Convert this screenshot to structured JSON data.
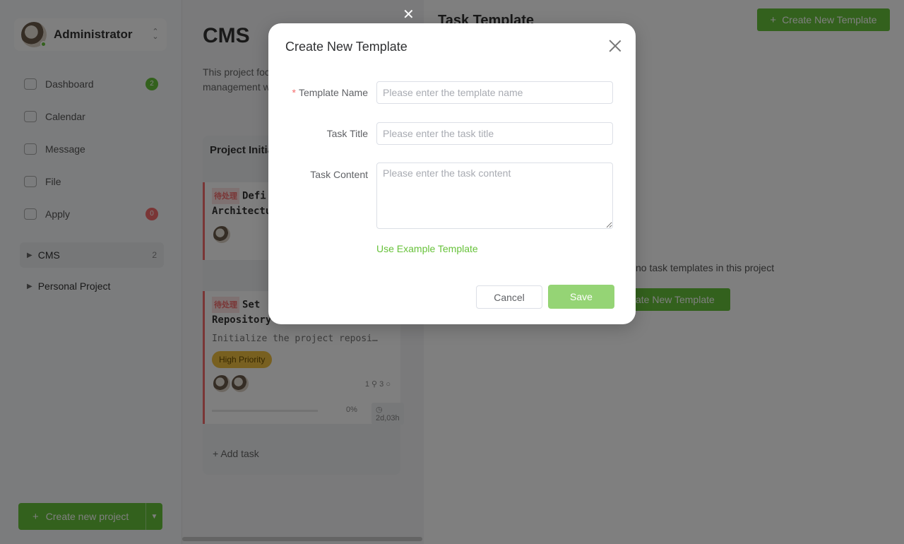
{
  "sidebar": {
    "user_name": "Administrator",
    "nav": [
      {
        "label": "Dashboard",
        "badge": "2",
        "badge_color": "#67c23a"
      },
      {
        "label": "Calendar"
      },
      {
        "label": "Message"
      },
      {
        "label": "File"
      },
      {
        "label": "Apply",
        "badge": "0",
        "badge_color": "#f56c6c"
      }
    ],
    "projects": [
      {
        "label": "CMS",
        "count": "2"
      },
      {
        "label": "Personal Project"
      }
    ],
    "create_project_label": "Create new project"
  },
  "main": {
    "project_title": "CMS",
    "project_desc": "This project focuses on the content management w",
    "column_title": "Project Initia",
    "tasks": [
      {
        "status": "待处理",
        "title": "Defi",
        "title_line2": "Architectu"
      },
      {
        "status": "待处理",
        "title": "Set",
        "title_line2": "Repository",
        "desc": "Initialize the project reposi…",
        "priority": "High Priority",
        "attachments": "1",
        "comments": "3",
        "progress": "0%",
        "time": "2d,03h"
      }
    ],
    "add_task_label": "Add task"
  },
  "drawer": {
    "title": "Task Template",
    "create_button": "Create New Template",
    "empty_text": "no task templates in this project",
    "empty_button": "eate New Template"
  },
  "modal": {
    "title": "Create New Template",
    "fields": {
      "template_name": {
        "label": "Template Name",
        "placeholder": "Please enter the template name",
        "required": true
      },
      "task_title": {
        "label": "Task Title",
        "placeholder": "Please enter the task title"
      },
      "task_content": {
        "label": "Task Content",
        "placeholder": "Please enter the task content"
      }
    },
    "example_link": "Use Example Template",
    "cancel_label": "Cancel",
    "save_label": "Save"
  },
  "colors": {
    "accent": "#67c23a",
    "accent_disabled": "#95d475",
    "danger": "#f56c6c"
  },
  "icons": {
    "drawer_close": "close-icon",
    "modal_close": "close-icon"
  }
}
